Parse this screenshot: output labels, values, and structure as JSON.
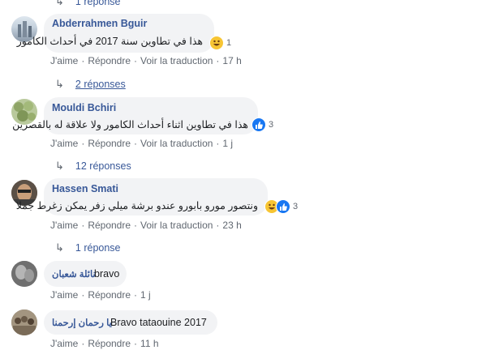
{
  "top_replies": "1 réponse",
  "comments": [
    {
      "author": "Abderrahmen Bguir",
      "text": "هذا في تطاوين سنة 2017 في أحداث الكامور",
      "reaction_count": "1",
      "actions": [
        "J'aime",
        "Répondre",
        "Voir la traduction",
        "17 h"
      ],
      "replies": "2 réponses"
    },
    {
      "author": "Mouldi Bchiri",
      "text": "هذا في تطاوين اثناء أحداث الكامور ولا علاقة له بالقصرين",
      "reaction_count": "3",
      "actions": [
        "J'aime",
        "Répondre",
        "Voir la traduction",
        "1 j"
      ],
      "replies": "12 réponses"
    },
    {
      "author": "Hassen Smati",
      "text": "ونتصور مورو بابورو عندو برشة ميلي زفر يمكن زغرط جملا",
      "reaction_count": "3",
      "actions": [
        "J'aime",
        "Répondre",
        "Voir la traduction",
        "23 h"
      ],
      "replies": "1 réponse"
    },
    {
      "author": "نائلة شعبان",
      "text": "bravo",
      "actions": [
        "J'aime",
        "Répondre",
        "1 j"
      ]
    },
    {
      "author": "يا رحمان إرحمنا",
      "text": "Bravo tataouine 2017",
      "actions": [
        "J'aime",
        "Répondre",
        "11 h"
      ]
    }
  ],
  "colors": {
    "link": "#385898",
    "bubble": "#f2f3f5",
    "meta": "#606770",
    "like": "#1877f2",
    "haha": "#f7c533"
  },
  "icons": [
    "reply-arrow-icon",
    "haha-reaction-icon",
    "like-reaction-icon"
  ]
}
